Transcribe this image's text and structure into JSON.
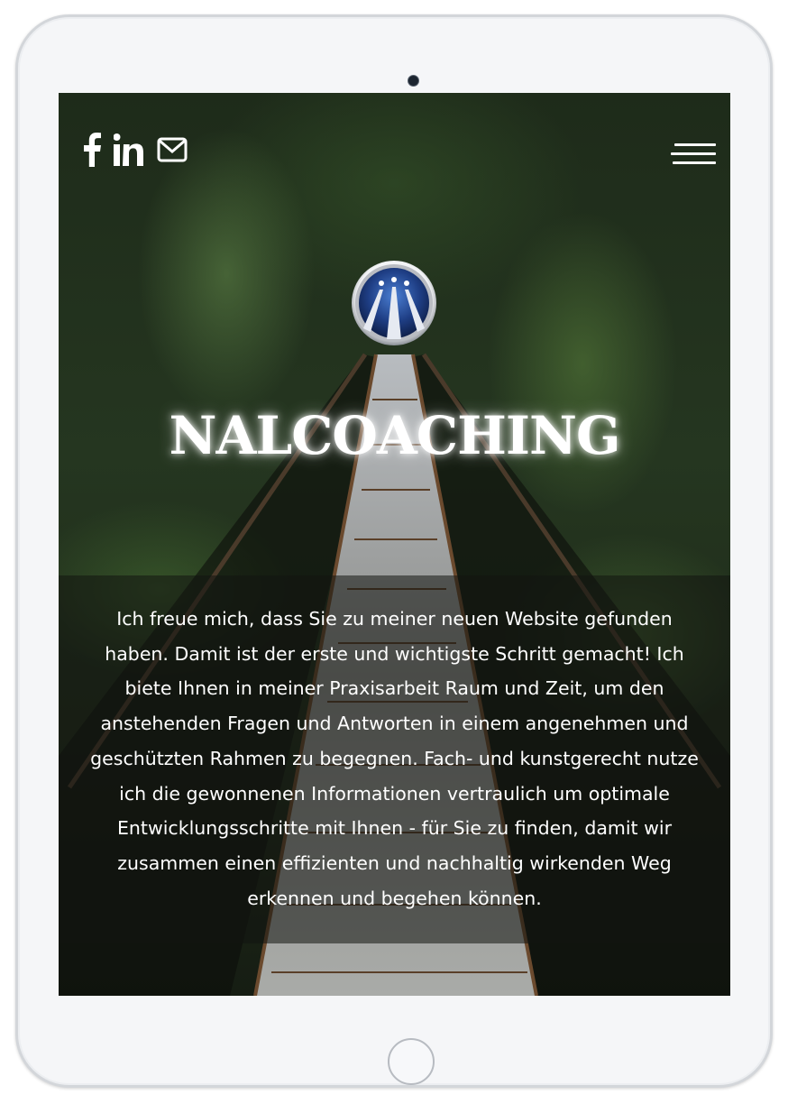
{
  "site": {
    "title": "NALCOACHING",
    "intro": "Ich freue mich, dass Sie zu meiner neuen Website gefunden haben. Damit ist der erste und wichtigste Schritt gemacht! Ich biete Ihnen in meiner Praxisarbeit Raum und Zeit, um den anstehenden Fragen und Antworten in einem angenehmen und geschützten Rahmen zu begegnen. Fach- und kunstgerecht nutze ich die gewonnenen Informationen vertraulich um optimale Entwicklungsschritte mit Ihnen - für Sie zu finden, damit wir zusammen einen effizienten und nachhaltig wirkenden Weg erkennen und begehen können."
  },
  "social_icons": [
    "facebook-icon",
    "linkedin-icon",
    "mail-icon"
  ],
  "menu_icon": "hamburger-menu-icon",
  "logo_icon": "awen-logo",
  "colors": {
    "text": "#ffffff",
    "forest": "#253620",
    "logo_blue": "#1f3f86",
    "device_frame": "#f5f6f8"
  }
}
